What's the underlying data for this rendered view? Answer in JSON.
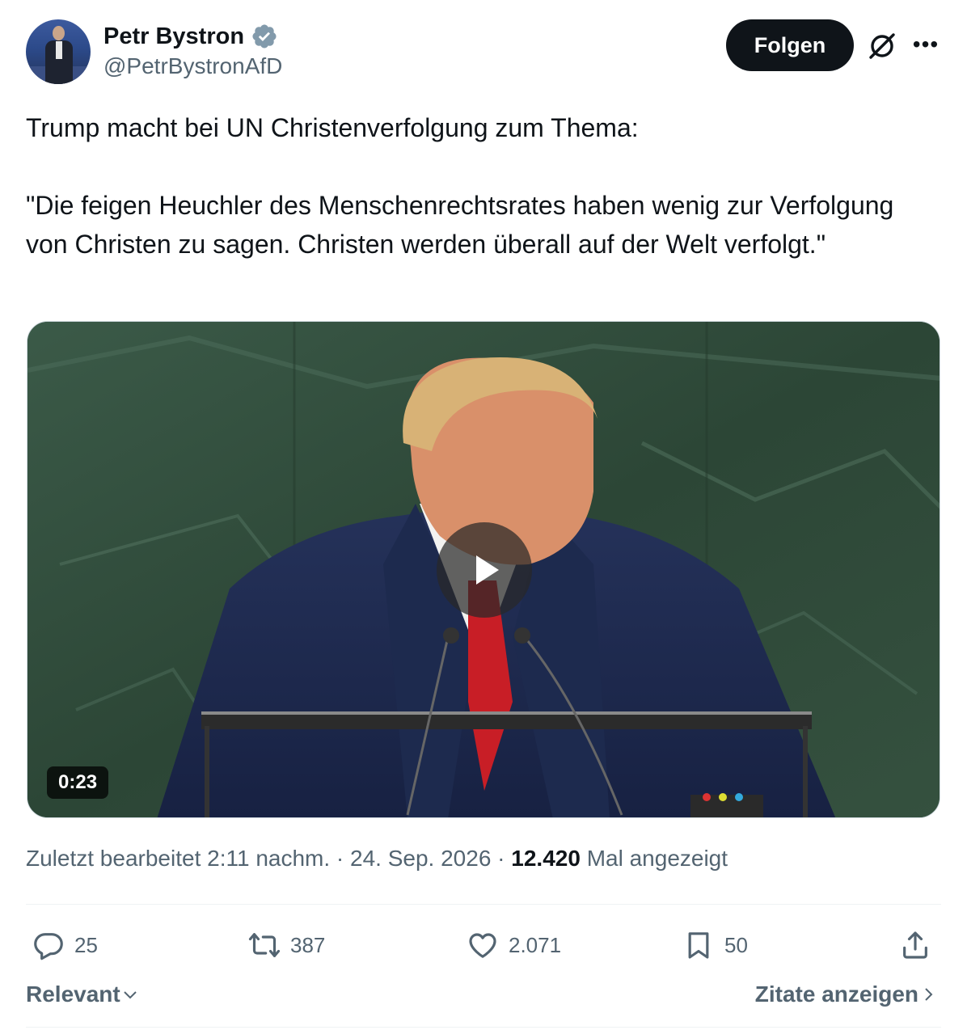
{
  "author": {
    "name": "Petr Bystron",
    "handle": "@PetrBystronAfD",
    "verified_color": "#829aab"
  },
  "header": {
    "follow_label": "Folgen",
    "grok_icon": "grok-icon",
    "more_icon": "more-icon"
  },
  "tweet": {
    "line1": "Trump macht bei UN Christenverfolgung zum Thema:",
    "quote": "\"Die feigen Heuchler des Menschenrechtsrates haben wenig zur Verfolgung von Christen zu sagen. Christen werden überall auf der Welt verfolgt.\""
  },
  "video": {
    "duration": "0:23",
    "play_icon": "play-icon"
  },
  "meta": {
    "edited": "Zuletzt bearbeitet 2:11 nachm. · 24. Sep. 2026 · ",
    "views_count": "12.420",
    "views_label": " Mal angezeigt"
  },
  "actions": {
    "replies": "25",
    "reposts": "387",
    "likes": "2.071",
    "bookmarks": "50"
  },
  "footer": {
    "sort_label": "Relevant",
    "quotes_label": "Zitate anzeigen"
  },
  "colors": {
    "text": "#0f1419",
    "secondary": "#536471",
    "follow_bg": "#0f1419"
  }
}
